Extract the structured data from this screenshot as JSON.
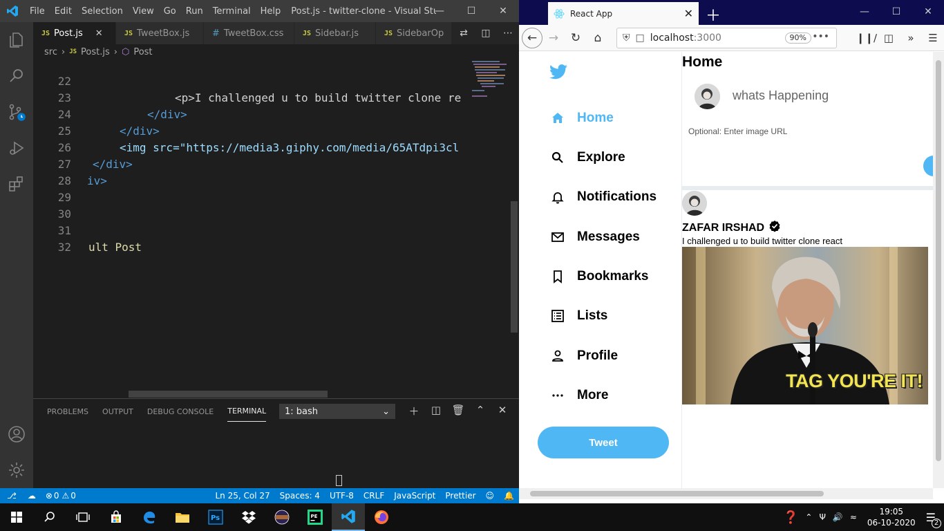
{
  "vscode": {
    "menu": [
      "File",
      "Edit",
      "Selection",
      "View",
      "Go",
      "Run",
      "Terminal",
      "Help"
    ],
    "window_title": "Post.js - twitter-clone - Visual Studio ...",
    "tabs": [
      {
        "icon": "JS",
        "label": "Post.js",
        "active": true
      },
      {
        "icon": "JS",
        "label": "TweetBox.js",
        "active": false
      },
      {
        "icon": "#",
        "label": "TweetBox.css",
        "active": false
      },
      {
        "icon": "JS",
        "label": "Sidebar.js",
        "active": false
      },
      {
        "icon": "JS",
        "label": "SidebarOp",
        "active": false
      }
    ],
    "breadcrumb": {
      "folder": "src",
      "file_icon": "JS",
      "file": "Post.js",
      "symbol": "Post"
    },
    "code_lines": [
      {
        "num": "22",
        "text": "<p>I challenged u to build twitter clone re"
      },
      {
        "num": "23",
        "text": "</div>"
      },
      {
        "num": "24",
        "text": "</div>"
      },
      {
        "num": "25",
        "text": "<img src=\"https://media3.giphy.com/media/65ATdpi3cl"
      },
      {
        "num": "26",
        "text": "</div>"
      },
      {
        "num": "27",
        "text": "iv>"
      },
      {
        "num": "28",
        "text": ""
      },
      {
        "num": "29",
        "text": ""
      },
      {
        "num": "30",
        "text": ""
      },
      {
        "num": "31",
        "text": "ult Post"
      },
      {
        "num": "32",
        "text": ""
      }
    ],
    "panel": {
      "tabs": [
        "PROBLEMS",
        "OUTPUT",
        "DEBUG CONSOLE",
        "TERMINAL"
      ],
      "terminal_select": "1: bash"
    },
    "status": {
      "errors": "0",
      "warnings": "0",
      "position": "Ln 25, Col 27",
      "spaces": "Spaces: 4",
      "encoding": "UTF-8",
      "eol": "CRLF",
      "language": "JavaScript",
      "formatter": "Prettier"
    }
  },
  "firefox": {
    "tab_title": "React App",
    "url_host": "localhost",
    "url_port": ":3000",
    "zoom": "90%",
    "sidebar": {
      "items": [
        {
          "label": "Home",
          "icon": "home-icon",
          "active": true
        },
        {
          "label": "Explore",
          "icon": "search-icon",
          "active": false
        },
        {
          "label": "Notifications",
          "icon": "bell-icon",
          "active": false
        },
        {
          "label": "Messages",
          "icon": "mail-icon",
          "active": false
        },
        {
          "label": "Bookmarks",
          "icon": "bookmark-icon",
          "active": false
        },
        {
          "label": "Lists",
          "icon": "list-icon",
          "active": false
        },
        {
          "label": "Profile",
          "icon": "person-icon",
          "active": false
        },
        {
          "label": "More",
          "icon": "more-icon",
          "active": false
        }
      ],
      "tweet_button": "Tweet"
    },
    "feed": {
      "title": "Home",
      "tweetbox_placeholder": "whats Happening",
      "image_url_placeholder": "Optional: Enter image URL",
      "post": {
        "display_name": "ZAFAR IRSHAD",
        "text": "I challenged u to build twitter clone react",
        "gif_caption": "TAG YOU'RE IT!"
      }
    },
    "accent_color": "#50b7f5"
  },
  "taskbar": {
    "time": "19:05",
    "date": "06-10-2020",
    "notifications": "2"
  }
}
